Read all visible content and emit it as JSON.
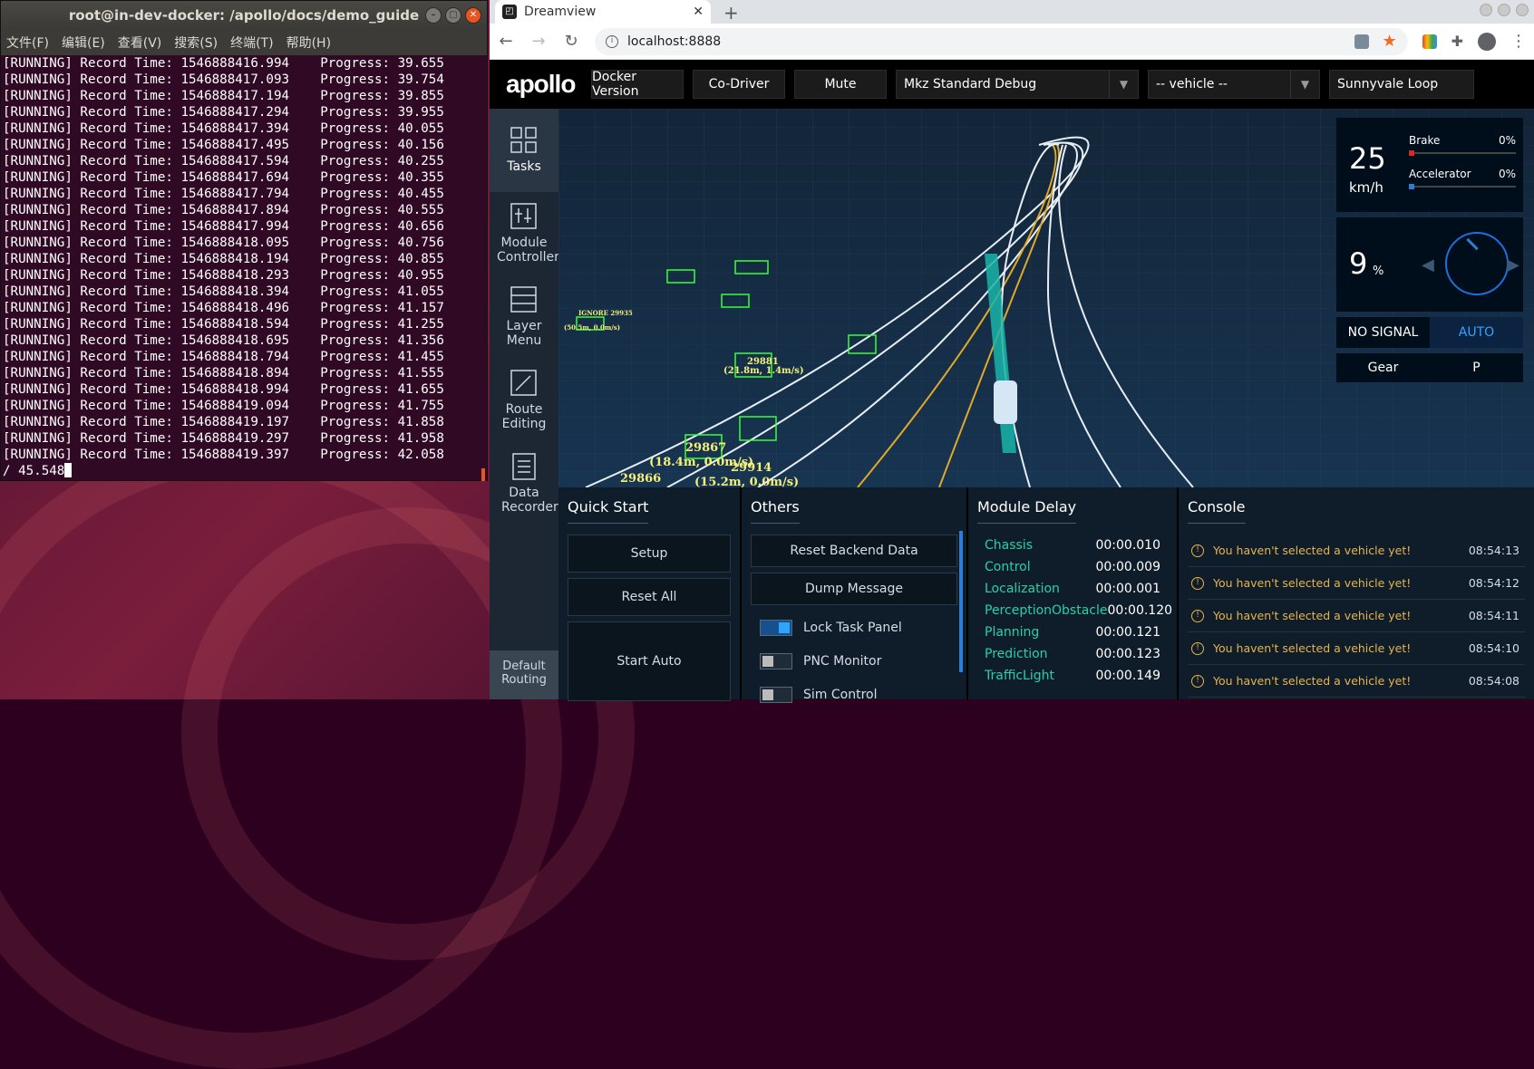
{
  "terminal": {
    "title": "root@in-dev-docker: /apollo/docs/demo_guide",
    "menu": [
      "文件(F)",
      "编辑(E)",
      "查看(V)",
      "搜索(S)",
      "终端(T)",
      "帮助(H)"
    ],
    "lines": [
      "[RUNNING] Record Time: 1546888416.994    Progress: 39.655",
      "[RUNNING] Record Time: 1546888417.093    Progress: 39.754",
      "[RUNNING] Record Time: 1546888417.194    Progress: 39.855",
      "[RUNNING] Record Time: 1546888417.294    Progress: 39.955",
      "[RUNNING] Record Time: 1546888417.394    Progress: 40.055",
      "[RUNNING] Record Time: 1546888417.495    Progress: 40.156",
      "[RUNNING] Record Time: 1546888417.594    Progress: 40.255",
      "[RUNNING] Record Time: 1546888417.694    Progress: 40.355",
      "[RUNNING] Record Time: 1546888417.794    Progress: 40.455",
      "[RUNNING] Record Time: 1546888417.894    Progress: 40.555",
      "[RUNNING] Record Time: 1546888417.994    Progress: 40.656",
      "[RUNNING] Record Time: 1546888418.095    Progress: 40.756",
      "[RUNNING] Record Time: 1546888418.194    Progress: 40.855",
      "[RUNNING] Record Time: 1546888418.293    Progress: 40.955",
      "[RUNNING] Record Time: 1546888418.394    Progress: 41.055",
      "[RUNNING] Record Time: 1546888418.496    Progress: 41.157",
      "[RUNNING] Record Time: 1546888418.594    Progress: 41.255",
      "[RUNNING] Record Time: 1546888418.695    Progress: 41.356",
      "[RUNNING] Record Time: 1546888418.794    Progress: 41.455",
      "[RUNNING] Record Time: 1546888418.894    Progress: 41.555",
      "[RUNNING] Record Time: 1546888418.994    Progress: 41.655",
      "[RUNNING] Record Time: 1546888419.094    Progress: 41.755",
      "[RUNNING] Record Time: 1546888419.197    Progress: 41.858",
      "[RUNNING] Record Time: 1546888419.297    Progress: 41.958",
      "[RUNNING] Record Time: 1546888419.397    Progress: 42.058"
    ],
    "last_line": "/ 45.548"
  },
  "browser": {
    "tab_title": "Dreamview",
    "url": "localhost:8888"
  },
  "header": {
    "logo": "apollo",
    "docker_version": "Docker Version",
    "co_driver": "Co-Driver",
    "mute": "Mute",
    "mode_select": "Mkz Standard Debug",
    "vehicle_select": "-- vehicle --",
    "map_select": "Sunnyvale Loop"
  },
  "sidenav": {
    "items": [
      "Tasks",
      "Module Controller",
      "Layer Menu",
      "Route Editing",
      "Data Recorder"
    ],
    "default_routing": "Default Routing"
  },
  "dashboard": {
    "speed": "25",
    "speed_unit": "km/h",
    "brake_label": "Brake",
    "brake_pct": "0%",
    "accel_label": "Accelerator",
    "accel_pct": "0%",
    "steering": "9",
    "steering_unit": "%",
    "signal": "NO SIGNAL",
    "drive_mode": "AUTO",
    "gear_label": "Gear",
    "gear_value": "P"
  },
  "scene": {
    "obstacles": [
      {
        "label": "29867",
        "sub": "(18.4m, 0.0m/s)"
      },
      {
        "label": "29914",
        "sub": "(15.2m, 0.0m/s)"
      },
      {
        "label": "29866",
        "sub": ""
      },
      {
        "label": "29881",
        "sub": "(21.8m, 1.4m/s)"
      },
      {
        "label": "IGNORE 29935",
        "sub": "(50.5m, 0.0m/s)"
      }
    ]
  },
  "quick_start": {
    "title": "Quick Start",
    "buttons": [
      "Setup",
      "Reset All",
      "Start Auto"
    ]
  },
  "others": {
    "title": "Others",
    "buttons": [
      "Reset Backend Data",
      "Dump Message"
    ],
    "toggles": [
      {
        "label": "Lock Task Panel",
        "on": true
      },
      {
        "label": "PNC Monitor",
        "on": false
      },
      {
        "label": "Sim Control",
        "on": false
      }
    ]
  },
  "module_delay": {
    "title": "Module Delay",
    "rows": [
      {
        "name": "Chassis",
        "value": "00:00.010"
      },
      {
        "name": "Control",
        "value": "00:00.009"
      },
      {
        "name": "Localization",
        "value": "00:00.001"
      },
      {
        "name": "PerceptionObstacle",
        "value": "00:00.120"
      },
      {
        "name": "Planning",
        "value": "00:00.121"
      },
      {
        "name": "Prediction",
        "value": "00:00.123"
      },
      {
        "name": "TrafficLight",
        "value": "00:00.149"
      }
    ]
  },
  "console": {
    "title": "Console",
    "messages": [
      {
        "text": "You haven't selected a vehicle yet!",
        "time": "08:54:13"
      },
      {
        "text": "You haven't selected a vehicle yet!",
        "time": "08:54:12"
      },
      {
        "text": "You haven't selected a vehicle yet!",
        "time": "08:54:11"
      },
      {
        "text": "You haven't selected a vehicle yet!",
        "time": "08:54:10"
      },
      {
        "text": "You haven't selected a vehicle yet!",
        "time": "08:54:08"
      }
    ]
  },
  "colors": {
    "accent": "#30a5ff",
    "module_name": "#28d1a8",
    "warning": "#e6b54a",
    "lane_yellow": "#e0a92a",
    "obstacle_green": "#39ff3a"
  }
}
